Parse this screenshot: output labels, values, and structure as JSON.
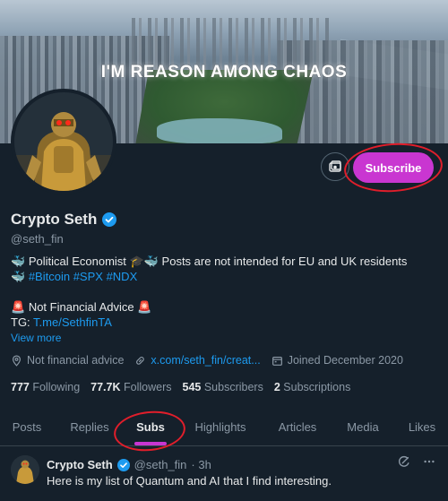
{
  "banner": {
    "tagline": "I'M REASON AMONG CHAOS"
  },
  "header": {
    "subscribe_label": "Subscribe"
  },
  "profile": {
    "display_name": "Crypto Seth",
    "handle": "@seth_fin",
    "bio": {
      "line1_a": "Political Economist",
      "line1_b": "Posts are not intended for EU and UK residents",
      "hashtags": [
        "#Bitcoin",
        "#SPX",
        "#NDX"
      ],
      "line3": "Not Financial Advice",
      "tg_prefix": "TG: ",
      "tg_link": "T.me/SethfinTA"
    },
    "view_more": "View more",
    "meta": {
      "location": "Not financial advice",
      "website": "x.com/seth_fin/creat...",
      "joined": "Joined December 2020"
    },
    "stats": {
      "following_count": "777",
      "following_label": "Following",
      "followers_count": "77.7K",
      "followers_label": "Followers",
      "subscribers_count": "545",
      "subscribers_label": "Subscribers",
      "subscriptions_count": "2",
      "subscriptions_label": "Subscriptions"
    }
  },
  "tabs": [
    {
      "label": "Posts",
      "active": false
    },
    {
      "label": "Replies",
      "active": false
    },
    {
      "label": "Subs",
      "active": true
    },
    {
      "label": "Highlights",
      "active": false
    },
    {
      "label": "Articles",
      "active": false
    },
    {
      "label": "Media",
      "active": false
    },
    {
      "label": "Likes",
      "active": false
    }
  ],
  "post": {
    "name": "Crypto Seth",
    "handle": "@seth_fin",
    "time": "· 3h",
    "text": "Here is my list of Quantum and AI that I find interesting."
  },
  "colors": {
    "background": "#15202b",
    "accent": "#c936d1",
    "link": "#1d9bf0",
    "annotation": "#e01e2b"
  }
}
